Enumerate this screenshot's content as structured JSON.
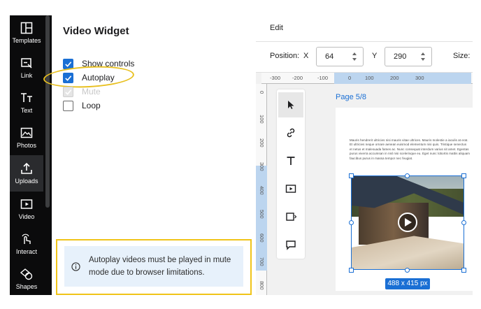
{
  "sidebar": {
    "items": [
      {
        "label": "Templates",
        "icon": "templates-icon"
      },
      {
        "label": "Link",
        "icon": "link-icon"
      },
      {
        "label": "Text",
        "icon": "text-icon"
      },
      {
        "label": "Photos",
        "icon": "photos-icon"
      },
      {
        "label": "Uploads",
        "icon": "uploads-icon"
      },
      {
        "label": "Video",
        "icon": "video-icon"
      },
      {
        "label": "Interact",
        "icon": "interact-icon"
      },
      {
        "label": "Shapes",
        "icon": "shapes-icon"
      }
    ]
  },
  "panel": {
    "title": "Video Widget",
    "options": [
      {
        "label": "Show controls",
        "checked": true,
        "disabled": false
      },
      {
        "label": "Autoplay",
        "checked": true,
        "disabled": false
      },
      {
        "label": "Mute",
        "checked": true,
        "disabled": true
      },
      {
        "label": "Loop",
        "checked": false,
        "disabled": false
      }
    ],
    "note": "Autoplay videos must be played in mute mode due to browser limitations."
  },
  "editor": {
    "title": "Edit",
    "position_label": "Position:",
    "x_label": "X",
    "x_value": "64",
    "y_label": "Y",
    "y_value": "290",
    "size_label": "Size:",
    "ruler_h": [
      "-300",
      "-200",
      "-100",
      "0",
      "100",
      "200",
      "300"
    ],
    "ruler_v": [
      "0",
      "100",
      "200",
      "300",
      "400",
      "500",
      "600",
      "700",
      "800"
    ],
    "page_label": "Page 5/8",
    "page_text": "Mauris hendrerit ultricies nisi mauris vitae ultrices. Mauris molestie a iaculis at erat. Et ultricies neque ornare aenean euismod elementum nisi quis. Tristique senectus et netus et malesuada fames ac. Nunc consequat interdum varius sit amet. Egestas purus viverra accumsan in nisl nisi scelerisque eu. Eget nunc lobortis mattis aliquam faucibus purus in massa tempor nec feugiat.",
    "size_badge": "488 x 415 px"
  },
  "colors": {
    "accent": "#1a6fd4",
    "highlight": "#f0c419",
    "sidebar_bg": "#0b0b0c"
  }
}
